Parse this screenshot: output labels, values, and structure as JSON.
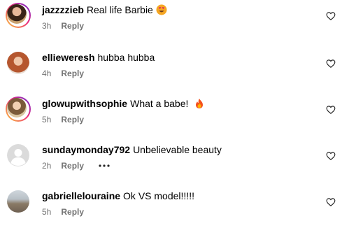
{
  "comments": [
    {
      "username": "jazzzzieb",
      "text": "Real life Barbie",
      "emoji": "smiling-face-with-heart-eyes-emoji",
      "time": "3h",
      "reply_label": "Reply",
      "has_story_ring": true
    },
    {
      "username": "ellieweresh",
      "text": "hubba hubba",
      "time": "4h",
      "reply_label": "Reply",
      "has_story_ring": false
    },
    {
      "username": "glowupwithsophie",
      "text": "What a babe!",
      "emoji": "fire-emoji",
      "time": "5h",
      "reply_label": "Reply",
      "has_story_ring": true
    },
    {
      "username": "sundaymonday792",
      "text": "Unbelievable beauty",
      "time": "2h",
      "reply_label": "Reply",
      "has_more_options": true,
      "has_story_ring": false
    },
    {
      "username": "gabriellelouraine",
      "text": "Ok VS model!!!!!",
      "time": "5h",
      "reply_label": "Reply",
      "has_story_ring": false
    }
  ],
  "icons": {
    "like": "heart-outline-icon",
    "more": "more-horizontal-icon",
    "default_avatar": "default-user-avatar-icon"
  },
  "colors": {
    "text_primary": "#000000",
    "text_secondary": "#737373",
    "story_ring_start": "#f9ce34",
    "story_ring_mid": "#ee2a7b",
    "story_ring_end": "#6228d7"
  }
}
